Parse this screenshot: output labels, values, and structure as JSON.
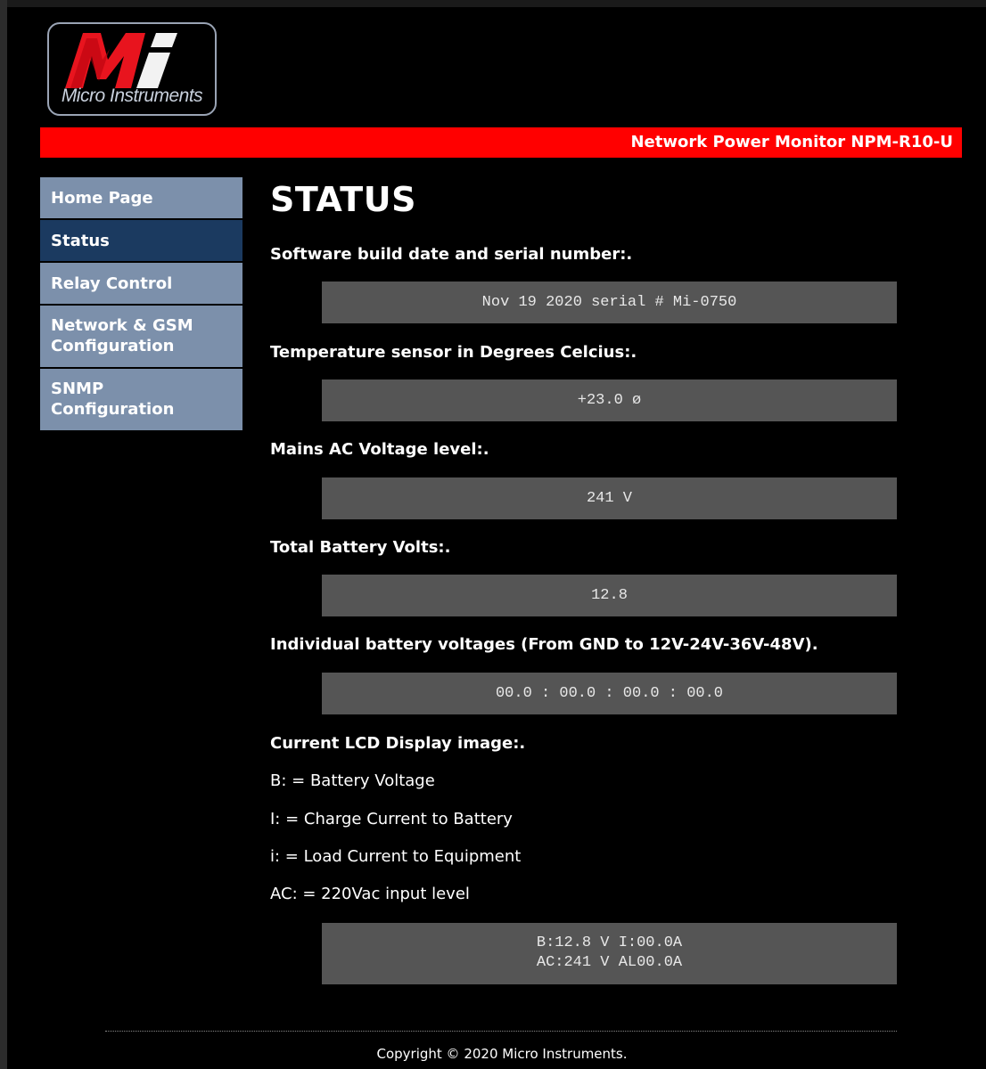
{
  "brand": {
    "logo_text": "Micro Instruments",
    "logo_mark": "Mi",
    "accent": "#ff0000"
  },
  "header": {
    "title": "Network Power Monitor NPM-R10-U"
  },
  "sidebar": {
    "items": [
      {
        "label_line1": "Home Page",
        "label_line2": ""
      },
      {
        "label_line1": "Status",
        "label_line2": ""
      },
      {
        "label_line1": "Relay Control",
        "label_line2": ""
      },
      {
        "label_line1": "Network & GSM",
        "label_line2": "Configuration"
      },
      {
        "label_line1": "SNMP",
        "label_line2": "Configuration"
      }
    ],
    "active": "Status"
  },
  "main": {
    "title": "STATUS",
    "sections": [
      {
        "label": "Software build date and serial number:.",
        "value": "Nov 19 2020 serial # Mi-0750"
      },
      {
        "label": "Temperature sensor in Degrees Celcius:.",
        "value": "+23.0 ø"
      },
      {
        "label": "Mains AC Voltage level:.",
        "value": "241 V"
      },
      {
        "label": "Total Battery Volts:.",
        "value": "12.8"
      },
      {
        "label": "Individual battery voltages (From GND to 12V-24V-36V-48V).",
        "value": "00.0 : 00.0 : 00.0 : 00.0"
      }
    ],
    "lcd": {
      "label": "Current LCD Display image:.",
      "legend": [
        "B: = Battery Voltage",
        "I: = Charge Current to Battery",
        "i: = Load Current to Equipment",
        "AC: = 220Vac input level"
      ],
      "line1": "B:12.8 V I:00.0A",
      "line2": "AC:241 V AL00.0A"
    }
  },
  "footer": {
    "copyright": "Copyright © 2020 Micro Instruments."
  }
}
